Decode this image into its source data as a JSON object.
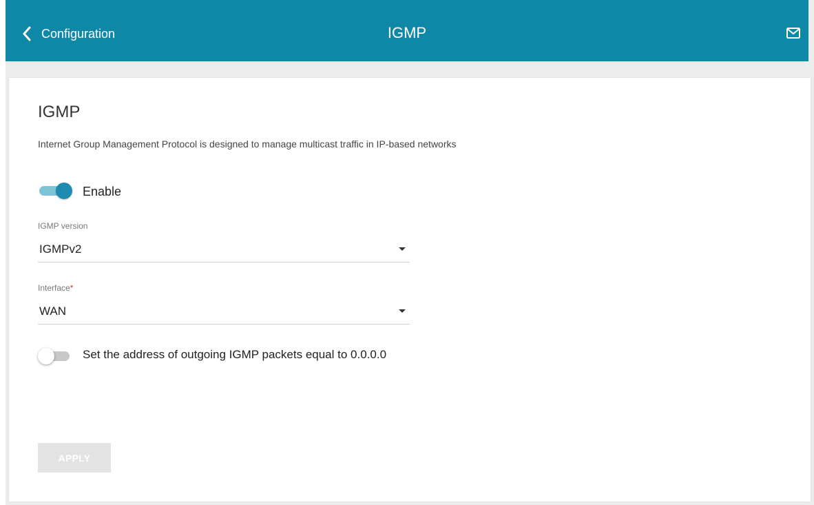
{
  "header": {
    "back_label": "Configuration",
    "title": "IGMP",
    "accent_color": "#0f88a8",
    "back_icon": "chevron-left-icon",
    "mail_icon": "mail-icon"
  },
  "section": {
    "title": "IGMP",
    "description": "Internet Group Management Protocol is designed to manage multicast traffic in IP-based networks"
  },
  "enable": {
    "label": "Enable",
    "state": "on"
  },
  "igmp_version": {
    "label": "IGMP version",
    "value": "IGMPv2"
  },
  "interface": {
    "label": "Interface",
    "required_mark": "*",
    "value": "WAN"
  },
  "outgoing_address": {
    "label": "Set the address of outgoing IGMP packets equal to 0.0.0.0",
    "state": "off"
  },
  "apply_button": {
    "label": "APPLY",
    "enabled": false
  }
}
